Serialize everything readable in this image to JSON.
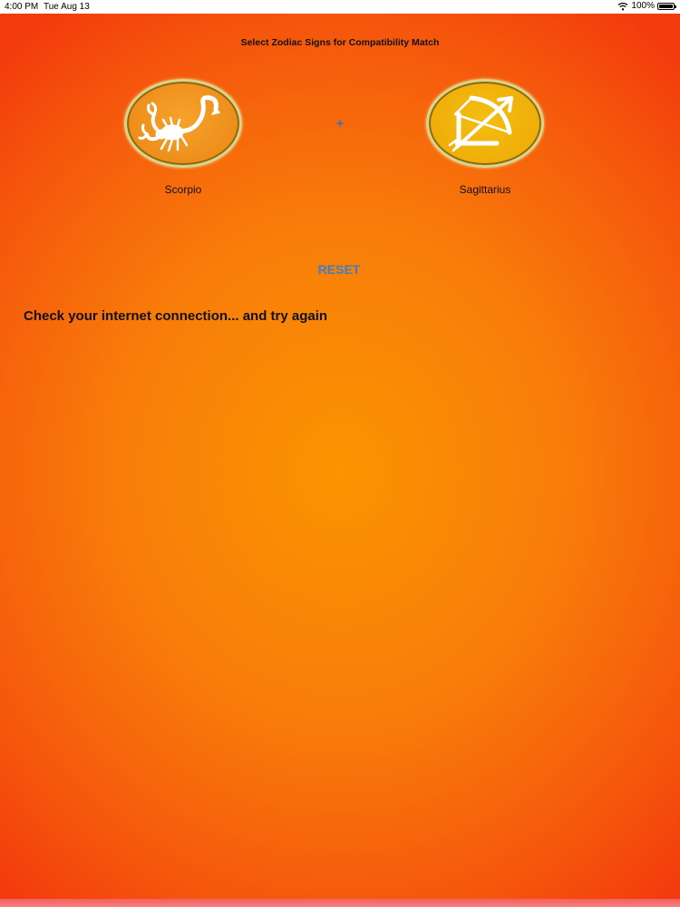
{
  "status_bar": {
    "time": "4:00 PM",
    "date": "Tue Aug 13",
    "battery": "100%",
    "wifi_icon": "wifi-icon",
    "battery_icon": "battery-icon"
  },
  "page": {
    "title": "Select Zodiac Signs for Compatibility Match",
    "plus": "+",
    "reset_label": "RESET",
    "error_message": "Check your internet connection... and try again"
  },
  "signs": [
    {
      "label": "Scorpio",
      "icon": "scorpio-icon",
      "color": "#ee8d1b"
    },
    {
      "label": "Sagittarius",
      "icon": "sagittarius-icon",
      "color": "#efae09"
    }
  ],
  "colors": {
    "background_center": "#fb9400",
    "background_edge": "#f33a0d",
    "accent": "#3f7dc6",
    "text": "#111111"
  }
}
